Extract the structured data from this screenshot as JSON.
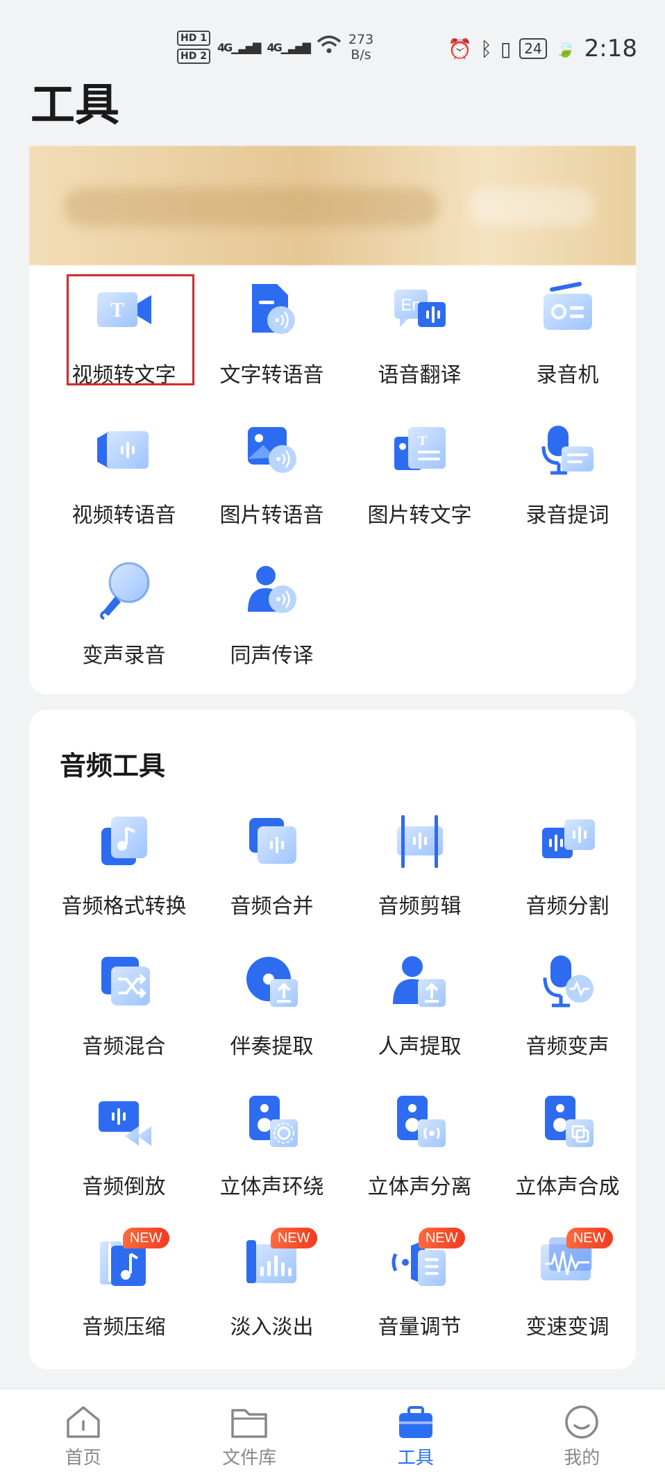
{
  "status_bar": {
    "sim1": "HD 1",
    "sim2": "HD 2",
    "signal1": "4G",
    "signal2": "4G",
    "net_speed_value": "273",
    "net_speed_unit": "B/s",
    "battery": "24",
    "time": "2:18"
  },
  "page": {
    "title": "工具"
  },
  "top_tools": [
    {
      "label": "视频转文字",
      "icon": "video-text-icon",
      "selected": true
    },
    {
      "label": "文字转语音",
      "icon": "doc-speaker-icon"
    },
    {
      "label": "语音翻译",
      "icon": "translate-en-icon"
    },
    {
      "label": "录音机",
      "icon": "radio-recorder-icon"
    },
    {
      "label": "视频转语音",
      "icon": "video-wave-icon"
    },
    {
      "label": "图片转语音",
      "icon": "image-speaker-icon"
    },
    {
      "label": "图片转文字",
      "icon": "image-text-icon"
    },
    {
      "label": "录音提词",
      "icon": "mic-prompter-icon"
    },
    {
      "label": "变声录音",
      "icon": "voice-changer-mic-icon"
    },
    {
      "label": "同声传译",
      "icon": "person-speaker-icon"
    }
  ],
  "audio_section": {
    "title": "音频工具",
    "tools": [
      {
        "label": "音频格式转换",
        "icon": "music-file-icon"
      },
      {
        "label": "音频合并",
        "icon": "merge-wave-icon"
      },
      {
        "label": "音频剪辑",
        "icon": "cut-wave-icon"
      },
      {
        "label": "音频分割",
        "icon": "split-wave-icon"
      },
      {
        "label": "音频混合",
        "icon": "shuffle-icon"
      },
      {
        "label": "伴奏提取",
        "icon": "disc-upload-icon"
      },
      {
        "label": "人声提取",
        "icon": "person-upload-icon"
      },
      {
        "label": "音频变声",
        "icon": "mic-wave-icon"
      },
      {
        "label": "音频倒放",
        "icon": "rewind-icon"
      },
      {
        "label": "立体声环绕",
        "icon": "speaker-surround-icon"
      },
      {
        "label": "立体声分离",
        "icon": "speaker-split-icon"
      },
      {
        "label": "立体声合成",
        "icon": "speaker-merge-icon"
      },
      {
        "label": "音频压缩",
        "icon": "compress-music-icon",
        "badge": "NEW"
      },
      {
        "label": "淡入淡出",
        "icon": "fade-bars-icon",
        "badge": "NEW"
      },
      {
        "label": "音量调节",
        "icon": "volume-icon",
        "badge": "NEW"
      },
      {
        "label": "变速变调",
        "icon": "speed-pitch-icon",
        "badge": "NEW"
      }
    ]
  },
  "bottom_nav": [
    {
      "label": "首页",
      "icon": "home-icon",
      "active": false
    },
    {
      "label": "文件库",
      "icon": "folder-icon",
      "active": false
    },
    {
      "label": "工具",
      "icon": "toolbox-icon",
      "active": true
    },
    {
      "label": "我的",
      "icon": "profile-smile-icon",
      "active": false
    }
  ],
  "colors": {
    "accent": "#2b6ff0",
    "icon_dark": "#2d6cf0",
    "icon_light": "#9ec4ff",
    "selection_border": "#d62a2a",
    "new_badge": "#f23a1f"
  }
}
